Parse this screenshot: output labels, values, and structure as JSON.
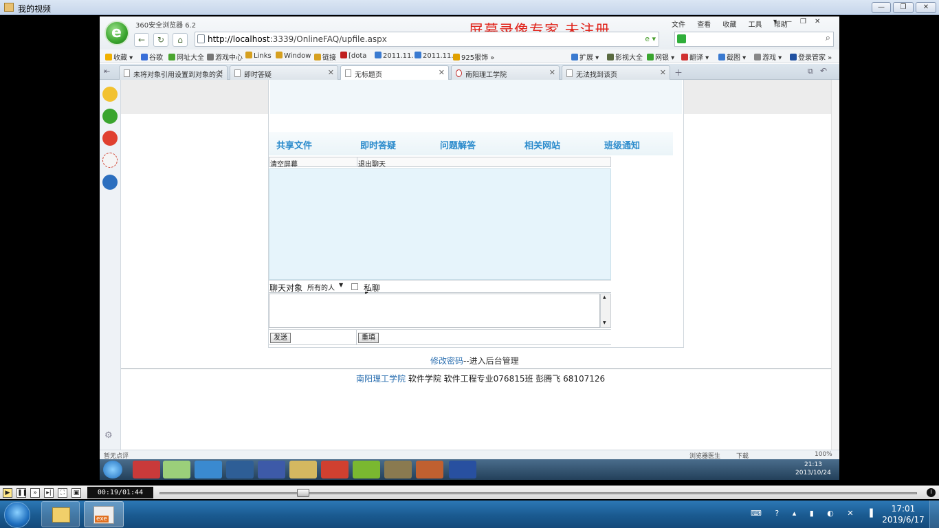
{
  "player": {
    "title": "我的视频",
    "time": "00:19/01:44",
    "progress": 0.19
  },
  "browser": {
    "title": "360安全浏览器 6.2",
    "url_host": "http://localhost",
    "url_rest": ":3339/OnlineFAQ/upfile.aspx",
    "watermark": "屏幕录像专家  未注册",
    "menu": [
      "文件",
      "查看",
      "收藏",
      "工具",
      "帮助"
    ],
    "bookmarks": [
      "收藏",
      "谷歌",
      "网址大全",
      "游戏中心",
      "Links",
      "Window",
      "链接",
      "[dota",
      "2011.11.",
      "2011.11.",
      "925狠饰"
    ],
    "toolbar_right": [
      "扩展",
      "影视大全",
      "网银",
      "翻译",
      "截图",
      "游戏",
      "登录管家"
    ],
    "tabs": [
      {
        "label": "未将对象引用设置到对象的实"
      },
      {
        "label": "即时答疑"
      },
      {
        "label": "无标题页"
      },
      {
        "label": "南阳理工学院"
      },
      {
        "label": "无法找到该页"
      }
    ],
    "status_left": "暂无点评",
    "status_right": [
      "浏览器医生",
      "下载"
    ],
    "zoom": "100%",
    "inner_clock": {
      "time": "21:13",
      "date": "2013/10/24"
    }
  },
  "page": {
    "nav": [
      "共享文件",
      "即时答疑",
      "问题解答",
      "相关网站",
      "班级通知"
    ],
    "clear_screen": "清空屏幕",
    "exit_chat": "退出聊天",
    "chat_target_label": "聊天对象",
    "chat_target_value": "所有的人",
    "private_label": "私聊",
    "send_button": "发送",
    "reset_button": "重填",
    "admin_link": "修改密码",
    "admin_text": "--进入后台管理",
    "footer_link": "南阳理工学院",
    "footer_text": "软件学院 软件工程专业076815班 彭腾飞 68107126"
  },
  "os": {
    "clock_time": "17:01",
    "clock_date": "2019/6/17",
    "task_app_label": "exe"
  }
}
